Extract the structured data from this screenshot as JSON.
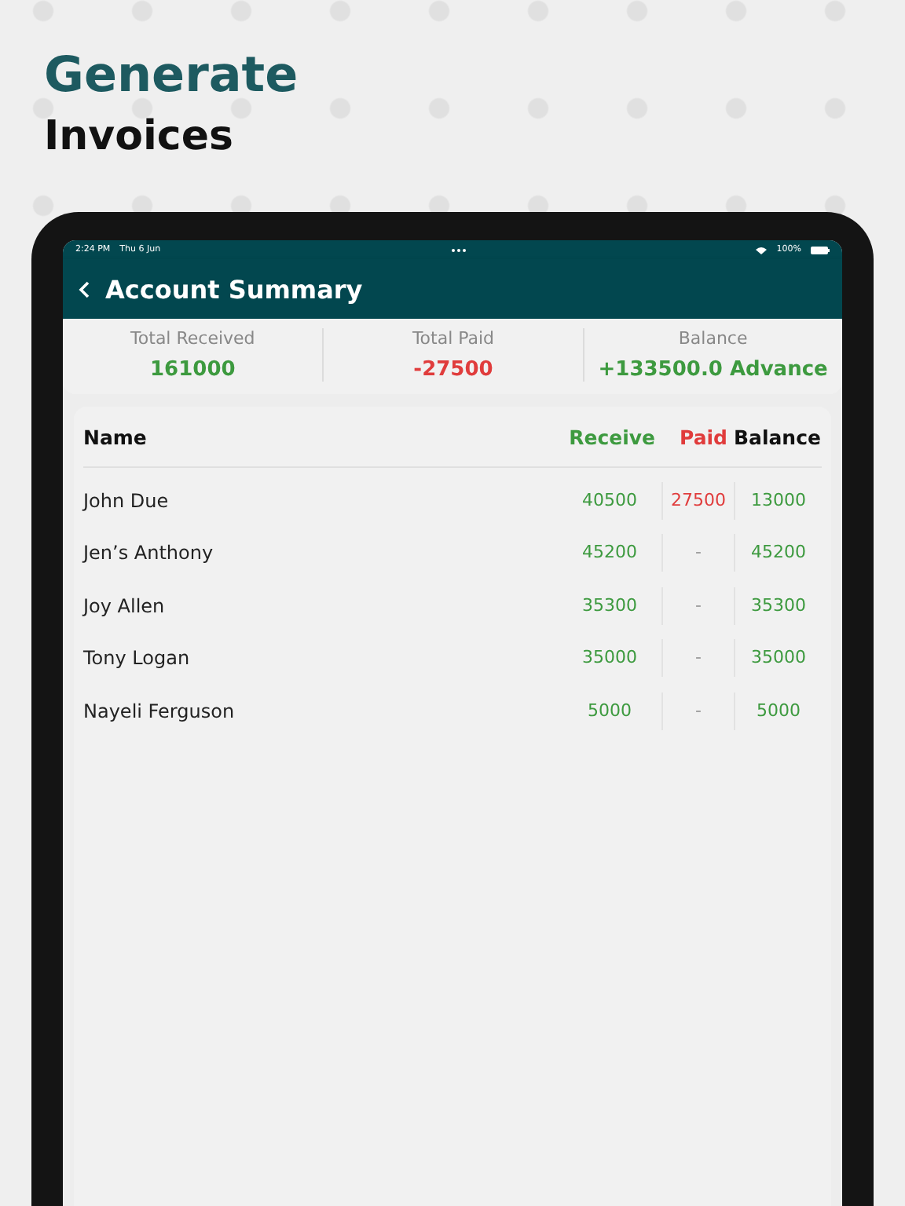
{
  "headline": {
    "line_1": "Generate",
    "line_2": "Invoices"
  },
  "status_bar": {
    "time": "2:24 PM",
    "date": "Thu 6 Jun",
    "battery": "100%"
  },
  "nav": {
    "title": "Account Summary"
  },
  "summary": [
    {
      "label": "Total Received",
      "value": "161000",
      "kind": "positive"
    },
    {
      "label": "Total Paid",
      "value": "-27500",
      "kind": "negative"
    },
    {
      "label": "Balance",
      "value": "+133500.0 Advance",
      "kind": "positive"
    }
  ],
  "table": {
    "columns": [
      {
        "label": "Name",
        "kind": "neutral"
      },
      {
        "label": "Receive",
        "kind": "positive"
      },
      {
        "label": "Paid",
        "kind": "negative"
      },
      {
        "label": "Balance",
        "kind": "neutral"
      }
    ],
    "rows": [
      {
        "name": "John Due",
        "receive": "40500",
        "paid": {
          "text": "27500",
          "kind": "negative"
        },
        "balance": "13000"
      },
      {
        "name": "Jen’s Anthony",
        "receive": "45200",
        "paid": {
          "text": "-",
          "kind": "empty"
        },
        "balance": "45200"
      },
      {
        "name": "Joy Allen",
        "receive": "35300",
        "paid": {
          "text": "-",
          "kind": "empty"
        },
        "balance": "35300"
      },
      {
        "name": "Tony Logan",
        "receive": "35000",
        "paid": {
          "text": "-",
          "kind": "empty"
        },
        "balance": "35000"
      },
      {
        "name": "Nayeli Ferguson",
        "receive": "5000",
        "paid": {
          "text": "-",
          "kind": "empty"
        },
        "balance": "5000"
      }
    ]
  }
}
